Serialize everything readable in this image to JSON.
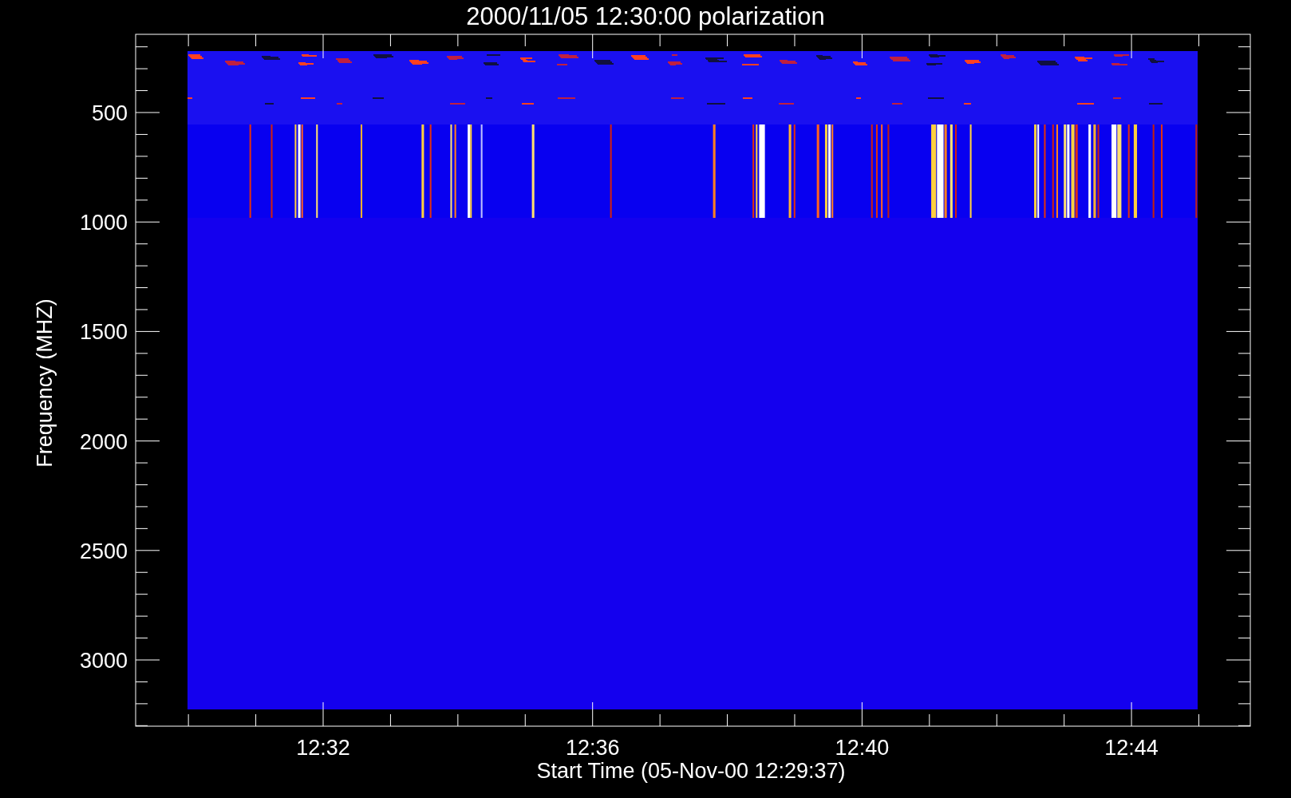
{
  "title": "2000/11/05 12:30:00 polarization",
  "plot": {
    "ylabel": "Frequency (MHZ)",
    "xlabel": "Start Time (05-Nov-00 12:29:37)",
    "yticks": [
      "500",
      "1000",
      "1500",
      "2000",
      "2500",
      "3000"
    ],
    "xticks": [
      "12:32",
      "12:36",
      "12:40",
      "12:44"
    ]
  }
}
